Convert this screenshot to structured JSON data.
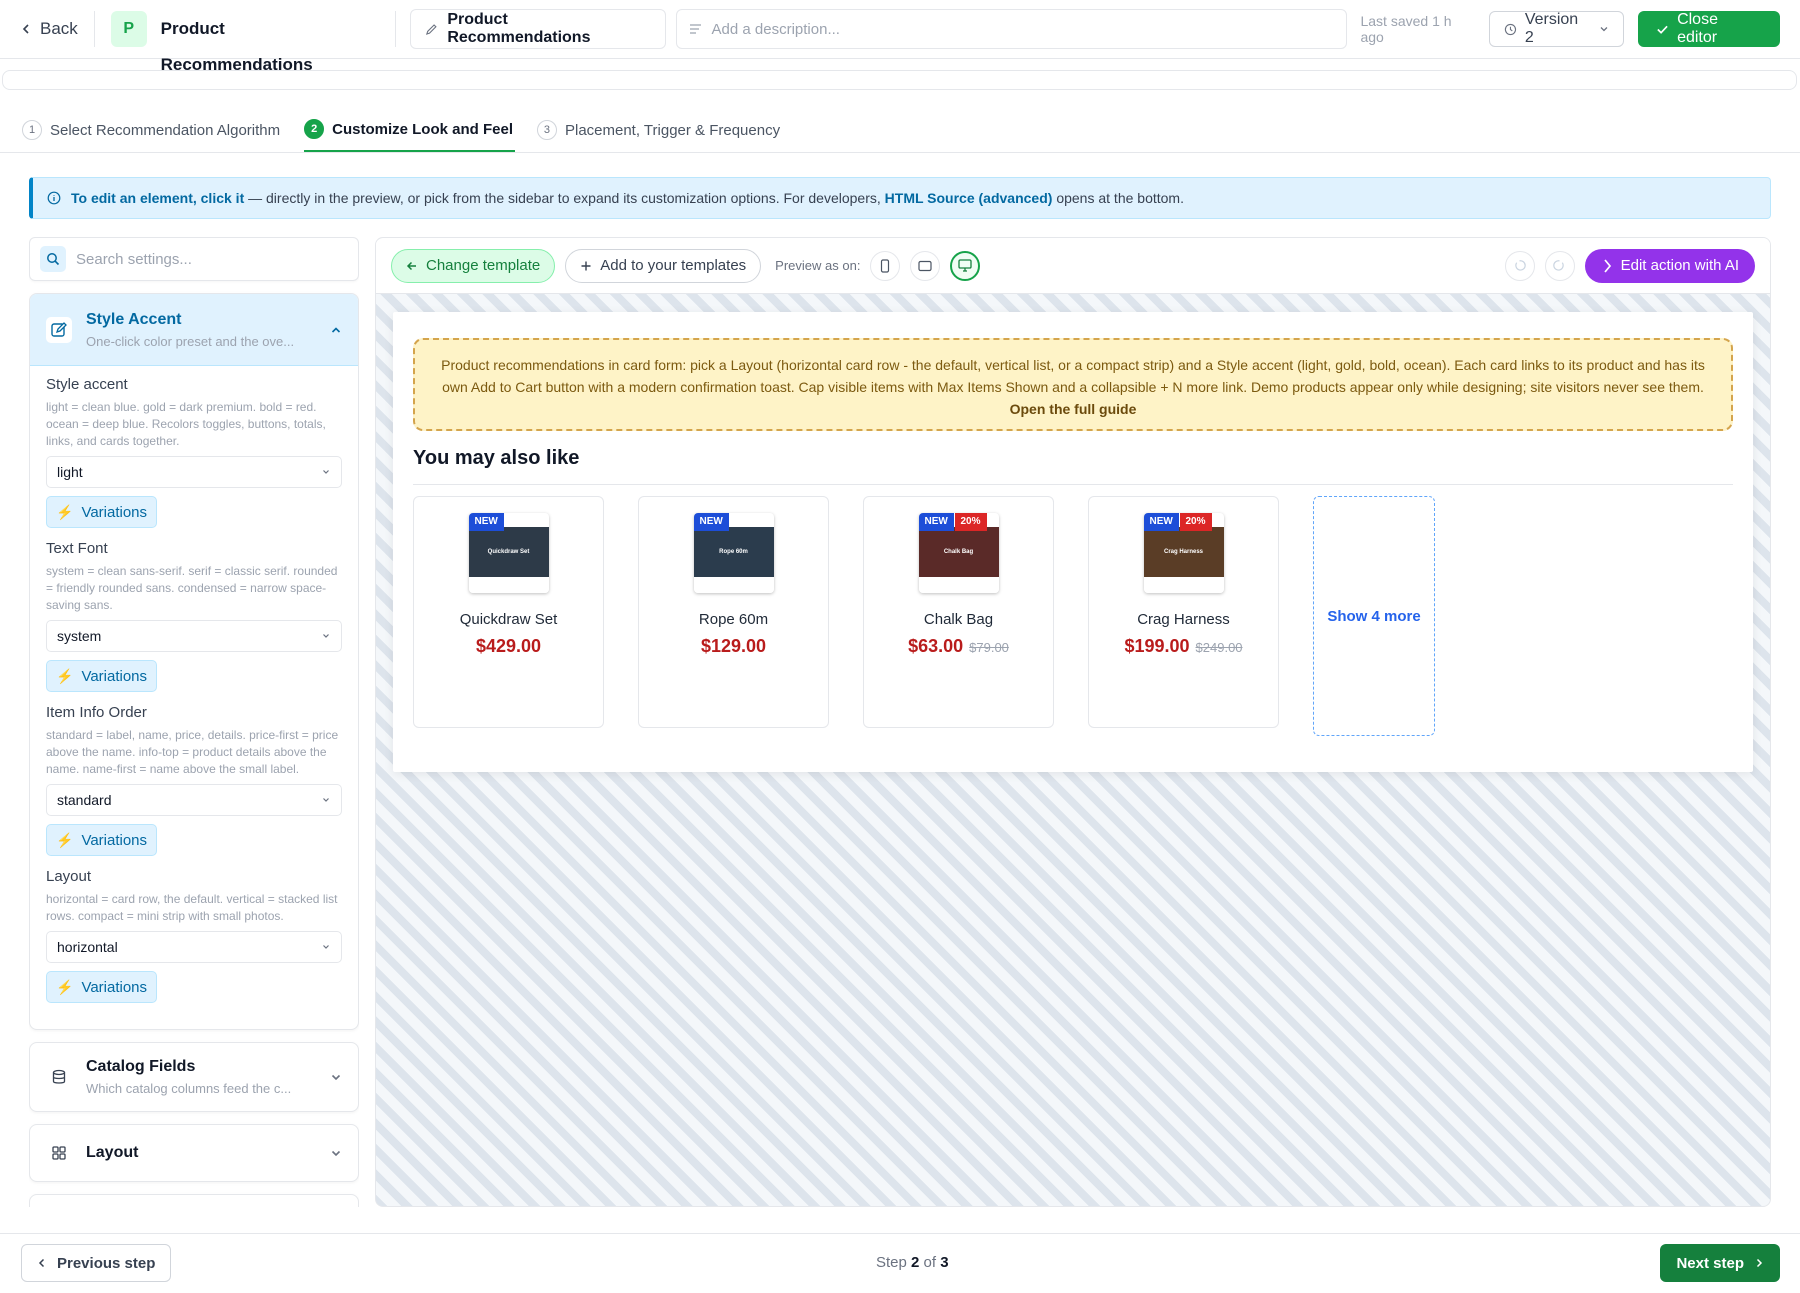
{
  "header": {
    "back_label": "Back",
    "app_initial": "P",
    "app_name": "Product Recommendations",
    "name_value": "Product Recommendations",
    "description_placeholder": "Add a description...",
    "last_saved": "Last saved 1 h ago",
    "version_label": "Version 2",
    "close_label": "Close editor"
  },
  "steps": [
    {
      "num": "1",
      "label": "Select Recommendation Algorithm"
    },
    {
      "num": "2",
      "label": "Customize Look and Feel",
      "active": true
    },
    {
      "num": "3",
      "label": "Placement, Trigger & Frequency"
    }
  ],
  "info": {
    "lead": "To edit an element, click it",
    "middle": " — directly in the preview, or pick from the sidebar to expand its customization options. For developers, ",
    "link": "HTML Source (advanced)",
    "tail": " opens at the bottom."
  },
  "sidebar": {
    "search_placeholder": "Search settings...",
    "style_panel": {
      "title": "Style Accent",
      "subtitle": "One-click color preset and the ove...",
      "fields": [
        {
          "label": "Style accent",
          "help": "light = clean blue. gold = dark premium. bold = red. ocean = deep blue. Recolors toggles, buttons, totals, links, and cards together.",
          "value": "light",
          "variations": "Variations"
        },
        {
          "label": "Text Font",
          "help": "system = clean sans-serif. serif = classic serif. rounded = friendly rounded sans. condensed = narrow space-saving sans.",
          "value": "system",
          "variations": "Variations"
        },
        {
          "label": "Item Info Order",
          "help": "standard = label, name, price, details. price-first = price above the name. info-top = product details above the name. name-first = name above the small label.",
          "value": "standard",
          "variations": "Variations"
        },
        {
          "label": "Layout",
          "help": "horizontal = card row, the default. vertical = stacked list rows. compact = mini strip with small photos.",
          "value": "horizontal",
          "variations": "Variations"
        }
      ]
    },
    "catalog_panel": {
      "title": "Catalog Fields",
      "subtitle": "Which catalog columns feed the c..."
    },
    "layout_panel": {
      "title": "Layout"
    }
  },
  "toolbar": {
    "change_template": "Change template",
    "add_template": "Add to your templates",
    "preview_as": "Preview as on:",
    "ai_label": "Edit action with AI"
  },
  "preview": {
    "note_text": "Product recommendations in card form: pick a Layout (horizontal card row - the default, vertical list, or a compact strip) and a Style accent (light, gold, bold, ocean). Each card links to its product and has its own Add to Cart button with a modern confirmation toast. Cap visible items with Max Items Shown and a collapsible + N more link. Demo products appear only while designing; site visitors never see them. ",
    "note_link": "Open the full guide",
    "title": "You may also like",
    "products": [
      {
        "name": "Quickdraw Set",
        "price": "$429.00",
        "old_price": "",
        "badge_new": "NEW",
        "badge_sale": "",
        "thumb_text": "Quickdraw Set",
        "color": "#2d3a48"
      },
      {
        "name": "Rope 60m",
        "price": "$129.00",
        "old_price": "",
        "badge_new": "NEW",
        "badge_sale": "",
        "thumb_text": "Rope 60m",
        "color": "#2b3c4d"
      },
      {
        "name": "Chalk Bag",
        "price": "$63.00",
        "old_price": "$79.00",
        "badge_new": "NEW",
        "badge_sale": "20%",
        "thumb_text": "Chalk Bag",
        "color": "#5a2a28"
      },
      {
        "name": "Crag Harness",
        "price": "$199.00",
        "old_price": "$249.00",
        "badge_new": "NEW",
        "badge_sale": "20%",
        "thumb_text": "Crag Harness",
        "color": "#5a3d26"
      }
    ],
    "show_more": "Show 4 more"
  },
  "footer": {
    "prev_label": "Previous step",
    "step_prefix": "Step ",
    "step_current": "2",
    "step_of": " of ",
    "step_total": "3",
    "next_label": "Next step"
  },
  "colors": {
    "primary_green": "#16a34a",
    "info_blue": "#0284c7",
    "ai_purple": "#9333ea",
    "price_red": "#b91c1c"
  }
}
